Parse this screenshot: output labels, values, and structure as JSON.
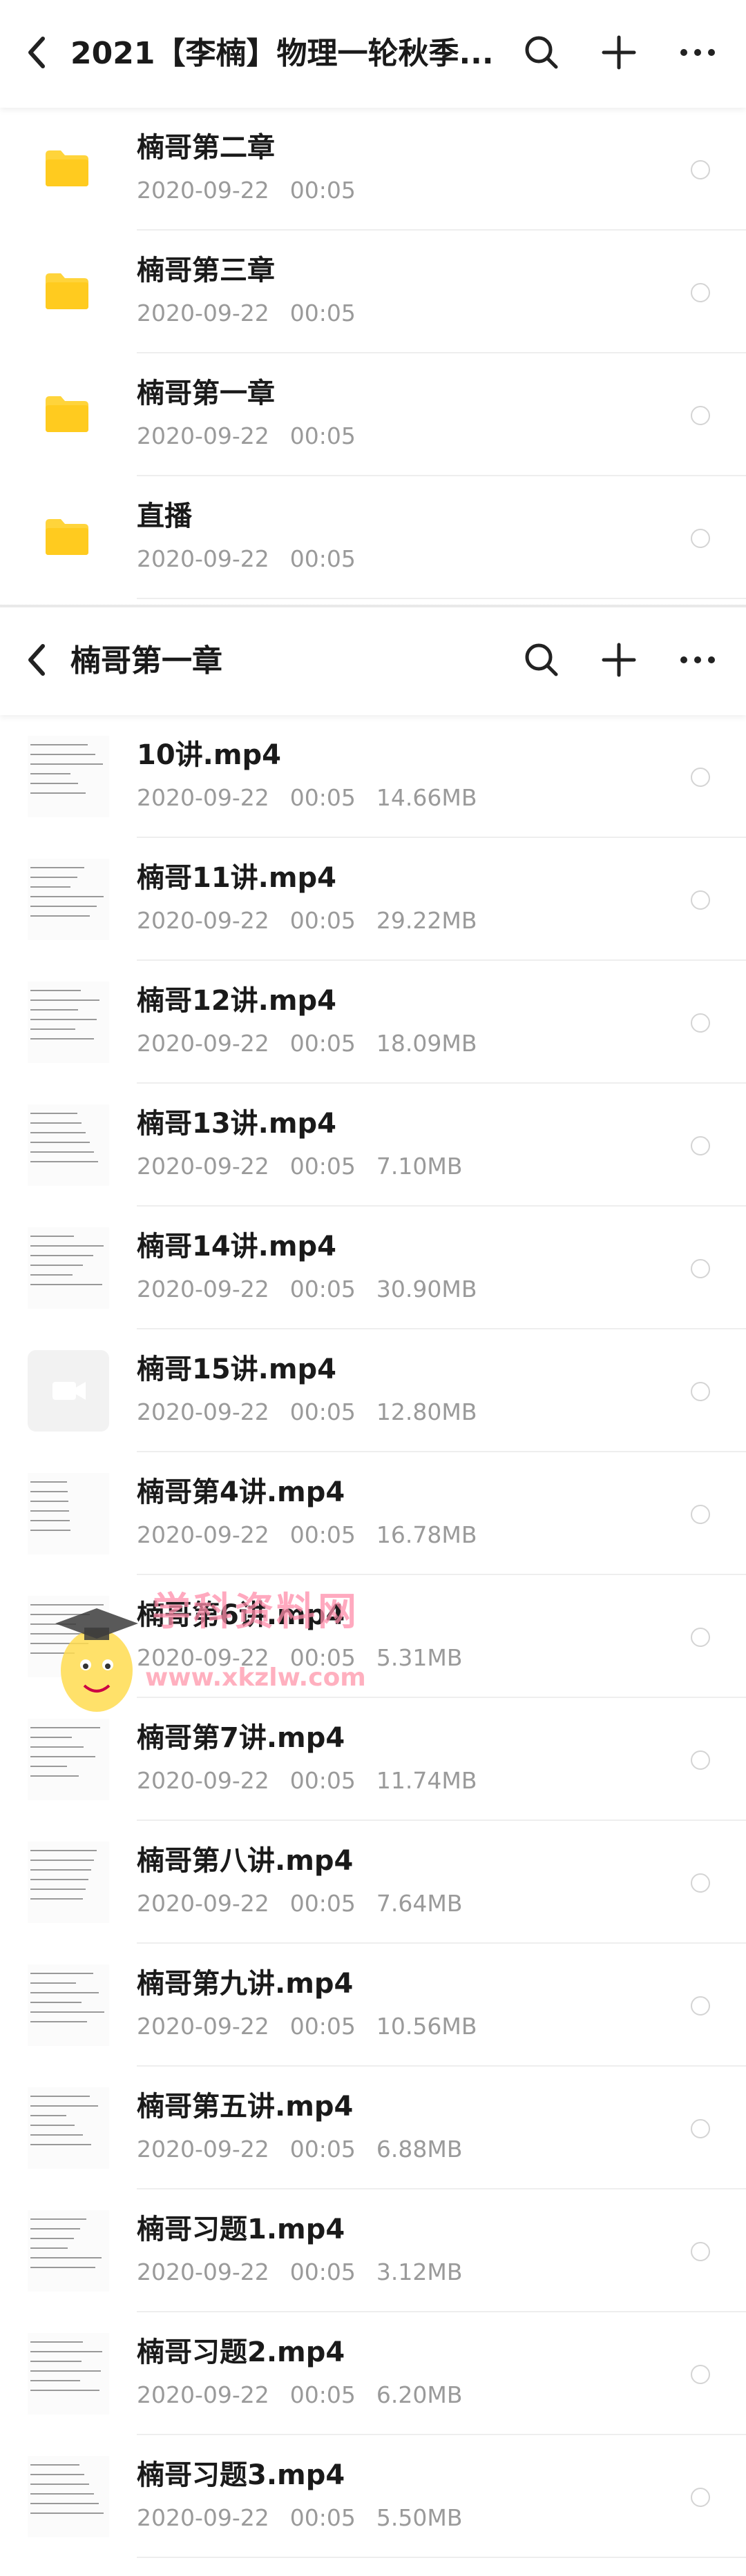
{
  "screen1": {
    "title": "2021【李楠】物理一轮秋季...",
    "folders": [
      {
        "name": "楠哥第二章",
        "date": "2020-09-22",
        "time": "00:05"
      },
      {
        "name": "楠哥第三章",
        "date": "2020-09-22",
        "time": "00:05"
      },
      {
        "name": "楠哥第一章",
        "date": "2020-09-22",
        "time": "00:05"
      },
      {
        "name": "直播",
        "date": "2020-09-22",
        "time": "00:05"
      }
    ]
  },
  "screen2": {
    "title": "楠哥第一章",
    "files": [
      {
        "name": "10讲.mp4",
        "date": "2020-09-22",
        "time": "00:05",
        "size": "14.66MB"
      },
      {
        "name": "楠哥11讲.mp4",
        "date": "2020-09-22",
        "time": "00:05",
        "size": "29.22MB"
      },
      {
        "name": "楠哥12讲.mp4",
        "date": "2020-09-22",
        "time": "00:05",
        "size": "18.09MB"
      },
      {
        "name": "楠哥13讲.mp4",
        "date": "2020-09-22",
        "time": "00:05",
        "size": "7.10MB"
      },
      {
        "name": "楠哥14讲.mp4",
        "date": "2020-09-22",
        "time": "00:05",
        "size": "30.90MB"
      },
      {
        "name": "楠哥15讲.mp4",
        "date": "2020-09-22",
        "time": "00:05",
        "size": "12.80MB"
      },
      {
        "name": "楠哥第4讲.mp4",
        "date": "2020-09-22",
        "time": "00:05",
        "size": "16.78MB"
      },
      {
        "name": "楠哥第6讲.mp4",
        "date": "2020-09-22",
        "time": "00:05",
        "size": "5.31MB"
      },
      {
        "name": "楠哥第7讲.mp4",
        "date": "2020-09-22",
        "time": "00:05",
        "size": "11.74MB"
      },
      {
        "name": "楠哥第八讲.mp4",
        "date": "2020-09-22",
        "time": "00:05",
        "size": "7.64MB"
      },
      {
        "name": "楠哥第九讲.mp4",
        "date": "2020-09-22",
        "time": "00:05",
        "size": "10.56MB"
      },
      {
        "name": "楠哥第五讲.mp4",
        "date": "2020-09-22",
        "time": "00:05",
        "size": "6.88MB"
      },
      {
        "name": "楠哥习题1.mp4",
        "date": "2020-09-22",
        "time": "00:05",
        "size": "3.12MB"
      },
      {
        "name": "楠哥习题2.mp4",
        "date": "2020-09-22",
        "time": "00:05",
        "size": "6.20MB"
      },
      {
        "name": "楠哥习题3.mp4",
        "date": "2020-09-22",
        "time": "00:05",
        "size": "5.50MB"
      }
    ]
  },
  "watermark": {
    "line1": "学科资料网",
    "line2": "www.xkzlw.com"
  },
  "icons": {
    "back": "back-arrow-icon",
    "search": "search-icon",
    "add": "plus-icon",
    "more": "more-dots-icon",
    "folder": "folder-icon",
    "video": "video-camera-icon"
  },
  "colors": {
    "folder": "#FFD43B",
    "text": "#1a1a1a",
    "meta": "#9a9a9a",
    "radio": "#d4d4d4"
  }
}
